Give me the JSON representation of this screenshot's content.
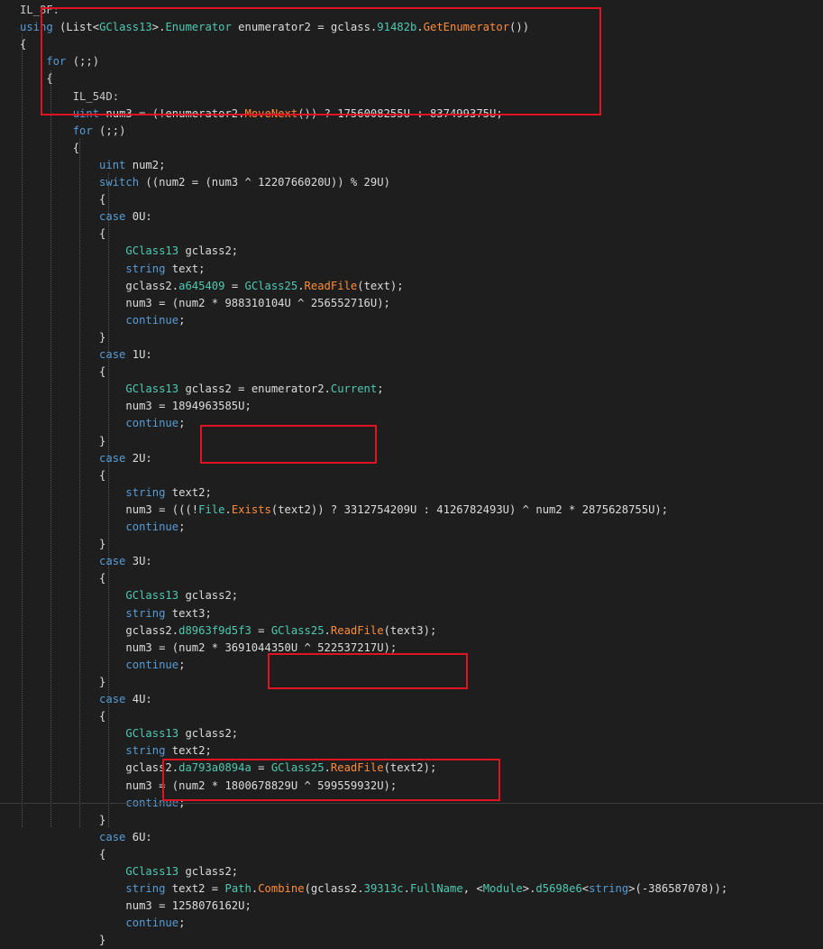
{
  "editor": {
    "lines": [
      [
        {
          "t": "IL_8F:",
          "c": "lbl"
        }
      ],
      [
        {
          "t": "using",
          "c": "kw"
        },
        {
          "t": " (List<",
          "c": "var"
        },
        {
          "t": "GClass13",
          "c": "type"
        },
        {
          "t": ">.",
          "c": "var"
        },
        {
          "t": "Enumerator",
          "c": "type"
        },
        {
          "t": " enumerator2 = gclass.",
          "c": "var"
        },
        {
          "t": "91482b",
          "c": "memb"
        },
        {
          "t": ".",
          "c": "var"
        },
        {
          "t": "GetEnumerator",
          "c": "fn"
        },
        {
          "t": "())",
          "c": "var"
        }
      ],
      [
        {
          "t": "{",
          "c": "var"
        }
      ],
      [
        {
          "t": "    for",
          "c": "kw"
        },
        {
          "t": " (;;)",
          "c": "var"
        }
      ],
      [
        {
          "t": "    {",
          "c": "var"
        }
      ],
      [
        {
          "t": "        IL_54D:",
          "c": "lbl"
        }
      ],
      [
        {
          "t": "        uint",
          "c": "kw"
        },
        {
          "t": " num3 = (!enumerator2.",
          "c": "var"
        },
        {
          "t": "MoveNext",
          "c": "fn"
        },
        {
          "t": "()) ? 1756008255U : 837499375U;",
          "c": "var"
        }
      ],
      [
        {
          "t": "        for",
          "c": "kw"
        },
        {
          "t": " (;;)",
          "c": "var"
        }
      ],
      [
        {
          "t": "        {",
          "c": "var"
        }
      ],
      [
        {
          "t": "            uint",
          "c": "kw"
        },
        {
          "t": " num2;",
          "c": "var"
        }
      ],
      [
        {
          "t": "            switch",
          "c": "kw"
        },
        {
          "t": " ((num2 = (num3 ^ 1220766020U)) % 29U)",
          "c": "var"
        }
      ],
      [
        {
          "t": "            {",
          "c": "var"
        }
      ],
      [
        {
          "t": "            case",
          "c": "kw"
        },
        {
          "t": " 0U:",
          "c": "var"
        }
      ],
      [
        {
          "t": "            {",
          "c": "var"
        }
      ],
      [
        {
          "t": "                GClass13",
          "c": "type"
        },
        {
          "t": " gclass2;",
          "c": "var"
        }
      ],
      [
        {
          "t": "                string",
          "c": "kw"
        },
        {
          "t": " text;",
          "c": "var"
        }
      ],
      [
        {
          "t": "                gclass2.",
          "c": "var"
        },
        {
          "t": "a645409",
          "c": "memb"
        },
        {
          "t": " = ",
          "c": "var"
        },
        {
          "t": "GClass25",
          "c": "type"
        },
        {
          "t": ".",
          "c": "var"
        },
        {
          "t": "ReadFile",
          "c": "fn"
        },
        {
          "t": "(text);",
          "c": "var"
        }
      ],
      [
        {
          "t": "                num3 = (num2 * 988310104U ^ 256552716U);",
          "c": "var"
        }
      ],
      [
        {
          "t": "                continue",
          "c": "kw"
        },
        {
          "t": ";",
          "c": "var"
        }
      ],
      [
        {
          "t": "            }",
          "c": "var"
        }
      ],
      [
        {
          "t": "            case",
          "c": "kw"
        },
        {
          "t": " 1U:",
          "c": "var"
        }
      ],
      [
        {
          "t": "            {",
          "c": "var"
        }
      ],
      [
        {
          "t": "                GClass13",
          "c": "type"
        },
        {
          "t": " gclass2 = enumerator2.",
          "c": "var"
        },
        {
          "t": "Current",
          "c": "prop"
        },
        {
          "t": ";",
          "c": "var"
        }
      ],
      [
        {
          "t": "                num3 = 1894963585U;",
          "c": "var"
        }
      ],
      [
        {
          "t": "                continue",
          "c": "kw"
        },
        {
          "t": ";",
          "c": "var"
        }
      ],
      [
        {
          "t": "            }",
          "c": "var"
        }
      ],
      [
        {
          "t": "            case",
          "c": "kw"
        },
        {
          "t": " 2U:",
          "c": "var"
        }
      ],
      [
        {
          "t": "            {",
          "c": "var"
        }
      ],
      [
        {
          "t": "                string",
          "c": "kw"
        },
        {
          "t": " text2;",
          "c": "var"
        }
      ],
      [
        {
          "t": "                num3 = (((!",
          "c": "var"
        },
        {
          "t": "File",
          "c": "type"
        },
        {
          "t": ".",
          "c": "var"
        },
        {
          "t": "Exists",
          "c": "fn"
        },
        {
          "t": "(text2)) ? 3312754209U : 4126782493U) ^ num2 * 2875628755U);",
          "c": "var"
        }
      ],
      [
        {
          "t": "                continue",
          "c": "kw"
        },
        {
          "t": ";",
          "c": "var"
        }
      ],
      [
        {
          "t": "            }",
          "c": "var"
        }
      ],
      [
        {
          "t": "            case",
          "c": "kw"
        },
        {
          "t": " 3U:",
          "c": "var"
        }
      ],
      [
        {
          "t": "            {",
          "c": "var"
        }
      ],
      [
        {
          "t": "                GClass13",
          "c": "type"
        },
        {
          "t": " gclass2;",
          "c": "var"
        }
      ],
      [
        {
          "t": "                string",
          "c": "kw"
        },
        {
          "t": " text3;",
          "c": "var"
        }
      ],
      [
        {
          "t": "                gclass2.",
          "c": "var"
        },
        {
          "t": "d8963f9d5f3",
          "c": "memb"
        },
        {
          "t": " = ",
          "c": "var"
        },
        {
          "t": "GClass25",
          "c": "type"
        },
        {
          "t": ".",
          "c": "var"
        },
        {
          "t": "ReadFile",
          "c": "fn"
        },
        {
          "t": "(text3);",
          "c": "var"
        }
      ],
      [
        {
          "t": "                num3 = (num2 * 3691044350U ^ 522537217U);",
          "c": "var"
        }
      ],
      [
        {
          "t": "                continue",
          "c": "kw"
        },
        {
          "t": ";",
          "c": "var"
        }
      ],
      [
        {
          "t": "            }",
          "c": "var"
        }
      ],
      [
        {
          "t": "            case",
          "c": "kw"
        },
        {
          "t": " 4U:",
          "c": "var"
        }
      ],
      [
        {
          "t": "            {",
          "c": "var"
        }
      ],
      [
        {
          "t": "                GClass13",
          "c": "type"
        },
        {
          "t": " gclass2;",
          "c": "var"
        }
      ],
      [
        {
          "t": "                string",
          "c": "kw"
        },
        {
          "t": " text2;",
          "c": "var"
        }
      ],
      [
        {
          "t": "                gclass2.",
          "c": "var"
        },
        {
          "t": "da793a0894a",
          "c": "memb"
        },
        {
          "t": " = ",
          "c": "var"
        },
        {
          "t": "GClass25",
          "c": "type"
        },
        {
          "t": ".",
          "c": "var"
        },
        {
          "t": "ReadFile",
          "c": "fn"
        },
        {
          "t": "(text2);",
          "c": "var"
        }
      ],
      [
        {
          "t": "                num3 = (num2 * 1800678829U ^ 599559932U);",
          "c": "var"
        }
      ],
      [
        {
          "t": "                continue",
          "c": "kw"
        },
        {
          "t": ";",
          "c": "var"
        }
      ],
      [
        {
          "t": "            }",
          "c": "var"
        }
      ],
      [
        {
          "t": "            case",
          "c": "kw"
        },
        {
          "t": " 6U:",
          "c": "var"
        }
      ],
      [
        {
          "t": "            {",
          "c": "var"
        }
      ],
      [
        {
          "t": "                GClass13",
          "c": "type"
        },
        {
          "t": " gclass2;",
          "c": "var"
        }
      ],
      [
        {
          "t": "                string",
          "c": "kw"
        },
        {
          "t": " text2 = ",
          "c": "var"
        },
        {
          "t": "Path",
          "c": "type"
        },
        {
          "t": ".",
          "c": "var"
        },
        {
          "t": "Combine",
          "c": "fn"
        },
        {
          "t": "(gclass2.",
          "c": "var"
        },
        {
          "t": "39313c",
          "c": "memb"
        },
        {
          "t": ".",
          "c": "var"
        },
        {
          "t": "FullName",
          "c": "prop"
        },
        {
          "t": ", <",
          "c": "var"
        },
        {
          "t": "Module",
          "c": "type"
        },
        {
          "t": ">.",
          "c": "var"
        },
        {
          "t": "d5698e6",
          "c": "memb"
        },
        {
          "t": "<",
          "c": "var"
        },
        {
          "t": "string",
          "c": "kw"
        },
        {
          "t": ">(-386587078));",
          "c": "var"
        }
      ],
      [
        {
          "t": "                num3 = 1258076162U;",
          "c": "var"
        }
      ],
      [
        {
          "t": "                continue",
          "c": "kw"
        },
        {
          "t": ";",
          "c": "var"
        }
      ],
      [
        {
          "t": "            }",
          "c": "var"
        }
      ]
    ]
  },
  "colors": {
    "background": "#1e1e1e",
    "highlight_box": "#e0141e",
    "keyword": "#569cd6",
    "type": "#4ec9b0",
    "method": "#ff8c3c",
    "text": "#dcdcdc"
  }
}
